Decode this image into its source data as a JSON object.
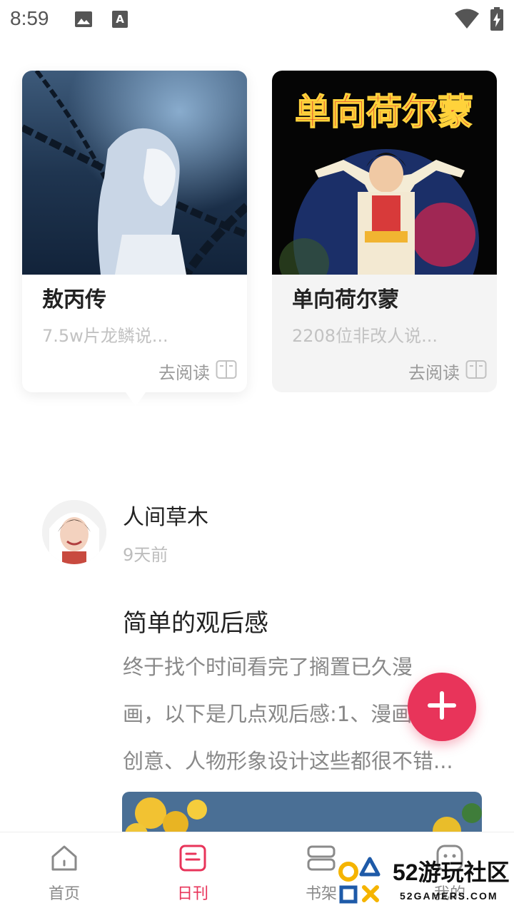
{
  "status_bar": {
    "time": "8:59",
    "icons": [
      "image-icon",
      "text-a-icon",
      "wifi-icon",
      "battery-charging-icon"
    ]
  },
  "books": [
    {
      "title": "敖丙传",
      "desc": "7.5w片龙鳞说...",
      "read_label": "去阅读"
    },
    {
      "title": "单向荷尔蒙",
      "desc": "2208位非改人说...",
      "read_label": "去阅读",
      "cover_title": "单向荷尔蒙"
    }
  ],
  "post": {
    "author": "人间草木",
    "time": "9天前",
    "title": "简单的观后感",
    "body_lines": [
      "终于找个时间看完了搁置已久漫",
      "画，以下是几点观后感:1、漫画内",
      "创意、人物形象设计这些都很不错..."
    ]
  },
  "nav": [
    {
      "label": "首页",
      "icon": "home-icon"
    },
    {
      "label": "日刊",
      "icon": "daily-icon",
      "active": true
    },
    {
      "label": "书架",
      "icon": "bookshelf-icon"
    },
    {
      "label": "我的",
      "icon": "profile-icon"
    }
  ],
  "watermark": {
    "title": "52游玩社区",
    "sub": "52GAMERS.COM"
  },
  "colors": {
    "accent": "#e8345a",
    "text": "#222222",
    "muted": "#c2c2c2"
  }
}
